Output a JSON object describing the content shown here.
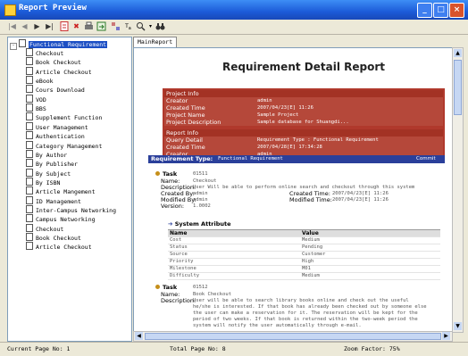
{
  "window": {
    "title": "Report Preview",
    "minimize": "_",
    "maximize": "□",
    "close": "×"
  },
  "toolbar": {
    "first": "◀",
    "prev": "◀",
    "next": "▶",
    "last": "▶|",
    "zoom": "🔍",
    "find": "👓"
  },
  "tree": {
    "root": "Functional Requirement",
    "items": [
      "Checkout",
      "Book Checkout",
      "Article Checkout",
      "eBook",
      "Cours Download",
      "VOD",
      "BBS",
      "Supplement Function",
      "User Management",
      "Authentication",
      "Category Management",
      "By Author",
      "By Publisher",
      "By Subject",
      "By ISBN",
      "Article Mangement",
      "ID Management",
      "Inter-Campus Networking",
      "Campus Networking",
      "Checkout",
      "Book Checkout",
      "Article Checkout"
    ]
  },
  "tab": {
    "label": "MainReport"
  },
  "report": {
    "title": "Requirement Detail Report",
    "project_info": {
      "header": "Project Info",
      "rows": [
        {
          "k": "Creator",
          "v": "admin"
        },
        {
          "k": "Created Time",
          "v": "2007/04/23[E] 11:26"
        },
        {
          "k": "Project Name",
          "v": "Sample Project"
        },
        {
          "k": "Project Description",
          "v": "Sample database for Shuangdi..."
        }
      ]
    },
    "report_info": {
      "header": "Report Info",
      "rows": [
        {
          "k": "Query Detail",
          "v": "Requirement Type : Functional Requirement"
        },
        {
          "k": "Created Time",
          "v": "2007/04/28[E] 17:34:28"
        },
        {
          "k": "Creator",
          "v": "admin"
        }
      ]
    },
    "req_type": {
      "label": "Requirement Type:",
      "value": "Functional Requirement",
      "right": "Commit"
    },
    "task1": {
      "title": "Task",
      "id": "01511",
      "name_label": "Name:",
      "name": "Checkout",
      "desc_label": "Description:",
      "desc": "User Will be able to perform online search and checkout through this system",
      "created_by_label": "Created By:",
      "created_by": "admin",
      "created_time_label": "Created Time:",
      "created_time": "2007/04/23[E] 11:26",
      "modified_by_label": "Modified By:",
      "modified_by": "admin",
      "modified_time_label": "Modified Time:",
      "modified_time": "2007/04/23[E] 11:26",
      "version_label": "Version:",
      "version": "1.0002"
    },
    "system_attr": {
      "title": "System Attribute",
      "col_name": "Name",
      "col_value": "Value",
      "rows": [
        {
          "name": "Cost",
          "value": "Medium"
        },
        {
          "name": "Status",
          "value": "Pending"
        },
        {
          "name": "Source",
          "value": "Customer"
        },
        {
          "name": "Priority",
          "value": "High"
        },
        {
          "name": "Milestone",
          "value": "M01"
        },
        {
          "name": "Difficulty",
          "value": "Medium"
        }
      ]
    },
    "task2": {
      "title": "Task",
      "id": "01512",
      "name_label": "Name:",
      "name": "Book Checkout",
      "desc_label": "Description:",
      "desc_lines": [
        "User will be able to search library books online and check out the useful",
        "he/she is interested. If that book has already been checked out by someone else",
        "the user can make a reservation for it. The reservation will be kept for the",
        "period of two weeks. If that book is returned within the two-week period the",
        "system will notify the user automatically through e-mail."
      ]
    }
  },
  "status": {
    "current": "Current Page No: 1",
    "total": "Total Page No: 8",
    "zoom": "Zoom Factor: 75%"
  }
}
